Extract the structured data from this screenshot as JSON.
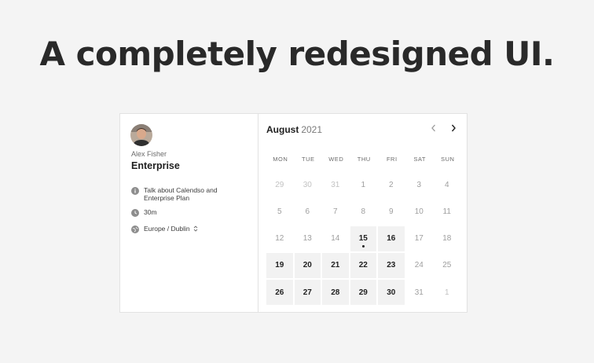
{
  "headline": "A completely redesigned UI.",
  "booking": {
    "organizer_name": "Alex Fisher",
    "event_title": "Enterprise",
    "description": "Talk about Calendso and Enterprise Plan",
    "duration": "30m",
    "timezone": "Europe / Dublin"
  },
  "calendar": {
    "month": "August",
    "year": "2021",
    "weekdays": [
      "MON",
      "TUE",
      "WED",
      "THU",
      "FRI",
      "SAT",
      "SUN"
    ],
    "days": [
      {
        "label": "29",
        "state": "muted"
      },
      {
        "label": "30",
        "state": "muted"
      },
      {
        "label": "31",
        "state": "muted"
      },
      {
        "label": "1",
        "state": "unavail"
      },
      {
        "label": "2",
        "state": "unavail"
      },
      {
        "label": "3",
        "state": "unavail"
      },
      {
        "label": "4",
        "state": "unavail"
      },
      {
        "label": "5",
        "state": "unavail"
      },
      {
        "label": "6",
        "state": "unavail"
      },
      {
        "label": "7",
        "state": "unavail"
      },
      {
        "label": "8",
        "state": "unavail"
      },
      {
        "label": "9",
        "state": "unavail"
      },
      {
        "label": "10",
        "state": "unavail"
      },
      {
        "label": "11",
        "state": "unavail"
      },
      {
        "label": "12",
        "state": "unavail"
      },
      {
        "label": "13",
        "state": "unavail"
      },
      {
        "label": "14",
        "state": "unavail"
      },
      {
        "label": "15",
        "state": "avail",
        "today": true
      },
      {
        "label": "16",
        "state": "avail"
      },
      {
        "label": "17",
        "state": "unavail"
      },
      {
        "label": "18",
        "state": "unavail"
      },
      {
        "label": "19",
        "state": "avail"
      },
      {
        "label": "20",
        "state": "avail"
      },
      {
        "label": "21",
        "state": "avail"
      },
      {
        "label": "22",
        "state": "avail"
      },
      {
        "label": "23",
        "state": "avail"
      },
      {
        "label": "24",
        "state": "unavail"
      },
      {
        "label": "25",
        "state": "unavail"
      },
      {
        "label": "26",
        "state": "avail"
      },
      {
        "label": "27",
        "state": "avail"
      },
      {
        "label": "28",
        "state": "avail"
      },
      {
        "label": "29",
        "state": "avail"
      },
      {
        "label": "30",
        "state": "avail"
      },
      {
        "label": "31",
        "state": "unavail"
      },
      {
        "label": "1",
        "state": "muted"
      }
    ]
  },
  "icons": {
    "info": "info-icon",
    "clock": "clock-icon",
    "globe": "globe-icon",
    "prev": "chevron-left-icon",
    "next": "chevron-right-icon",
    "selector": "chevron-up-down-icon"
  },
  "colors": {
    "background": "#f4f4f4",
    "card": "#ffffff",
    "text_dark": "#1f1f1f",
    "available_bg": "#f2f2f2"
  }
}
